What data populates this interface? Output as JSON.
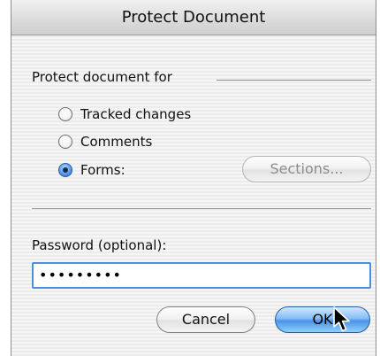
{
  "dialog": {
    "title": "Protect Document"
  },
  "protect_for": {
    "label": "Protect document for",
    "options": [
      {
        "label": "Tracked changes",
        "selected": false
      },
      {
        "label": "Comments",
        "selected": false
      },
      {
        "label": "Forms:",
        "selected": true
      }
    ],
    "sections_button": "Sections..."
  },
  "password": {
    "label": "Password (optional):",
    "value": "•••••••••"
  },
  "buttons": {
    "cancel": "Cancel",
    "ok": "OK"
  },
  "icons": {
    "cursor": "arrow-cursor-icon"
  }
}
